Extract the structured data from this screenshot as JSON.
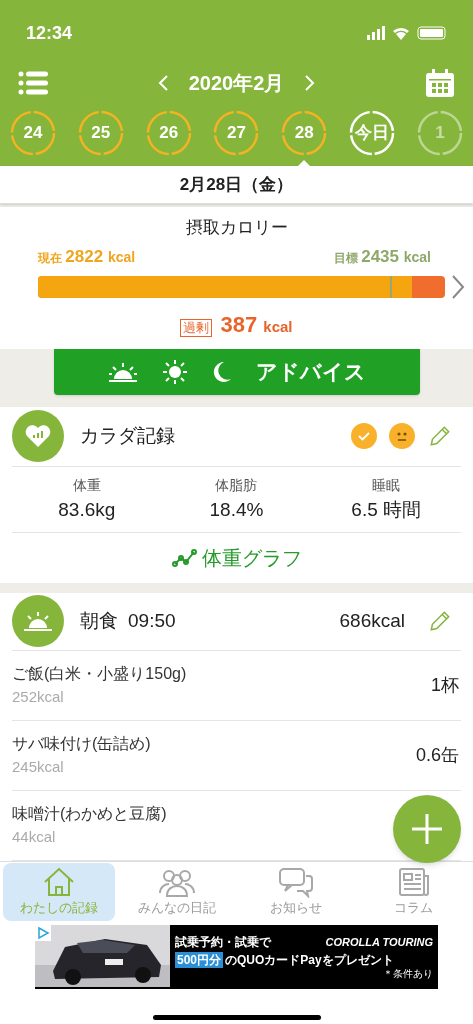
{
  "status_bar": {
    "time": "12:34"
  },
  "header": {
    "month": "2020年2月"
  },
  "days": [
    {
      "label": "24",
      "kind": "past",
      "selected": false
    },
    {
      "label": "25",
      "kind": "past",
      "selected": false
    },
    {
      "label": "26",
      "kind": "past",
      "selected": false
    },
    {
      "label": "27",
      "kind": "past",
      "selected": false
    },
    {
      "label": "28",
      "kind": "past",
      "selected": true
    },
    {
      "label": "今日",
      "kind": "today",
      "selected": false
    },
    {
      "label": "1",
      "kind": "future",
      "selected": false
    }
  ],
  "date": "2月28日（金）",
  "calories": {
    "title": "摂取カロリー",
    "current_label": "現在",
    "current_value": "2822",
    "current_unit": "kcal",
    "target_label": "目標",
    "target_value": "2435",
    "target_unit": "kcal",
    "fill": {
      "level": 0.92
    },
    "target_marker": {
      "level": 0.866
    },
    "excess_label": "過剰",
    "excess_value": "387",
    "excess_unit": "kcal"
  },
  "advice_button": {
    "label": "アドバイス"
  },
  "body_record": {
    "title": "カラダ記録",
    "stats": [
      {
        "label": "体重",
        "value": "83.6kg"
      },
      {
        "label": "体脂肪",
        "value": "18.4%"
      },
      {
        "label": "睡眠",
        "value": "6.5 時間"
      }
    ],
    "graph_link": "体重グラフ"
  },
  "breakfast": {
    "title": "朝食",
    "time": "09:50",
    "total": "686kcal",
    "items": [
      {
        "name": "ご飯(白米・小盛り150g)",
        "kcal": "252kcal",
        "amount": "1杯"
      },
      {
        "name": "サバ味付け(缶詰め)",
        "kcal": "245kcal",
        "amount": "0.6缶"
      },
      {
        "name": "味噌汁(わかめと豆腐)",
        "kcal": "44kcal"
      }
    ]
  },
  "tab_bar": [
    {
      "label": "わたしの記録",
      "kind": "home",
      "selected": true
    },
    {
      "label": "みんなの日記",
      "kind": "people",
      "selected": false
    },
    {
      "label": "お知らせ",
      "kind": "chat",
      "selected": false
    },
    {
      "label": "コラム",
      "kind": "news",
      "selected": false
    }
  ],
  "ad": {
    "line_1": "試乗予約・試乗で",
    "brand": "COROLLA TOURING",
    "highlight": "500円分",
    "line_2": "のQUOカードPayをプレゼント",
    "note": "＊条件あり"
  }
}
